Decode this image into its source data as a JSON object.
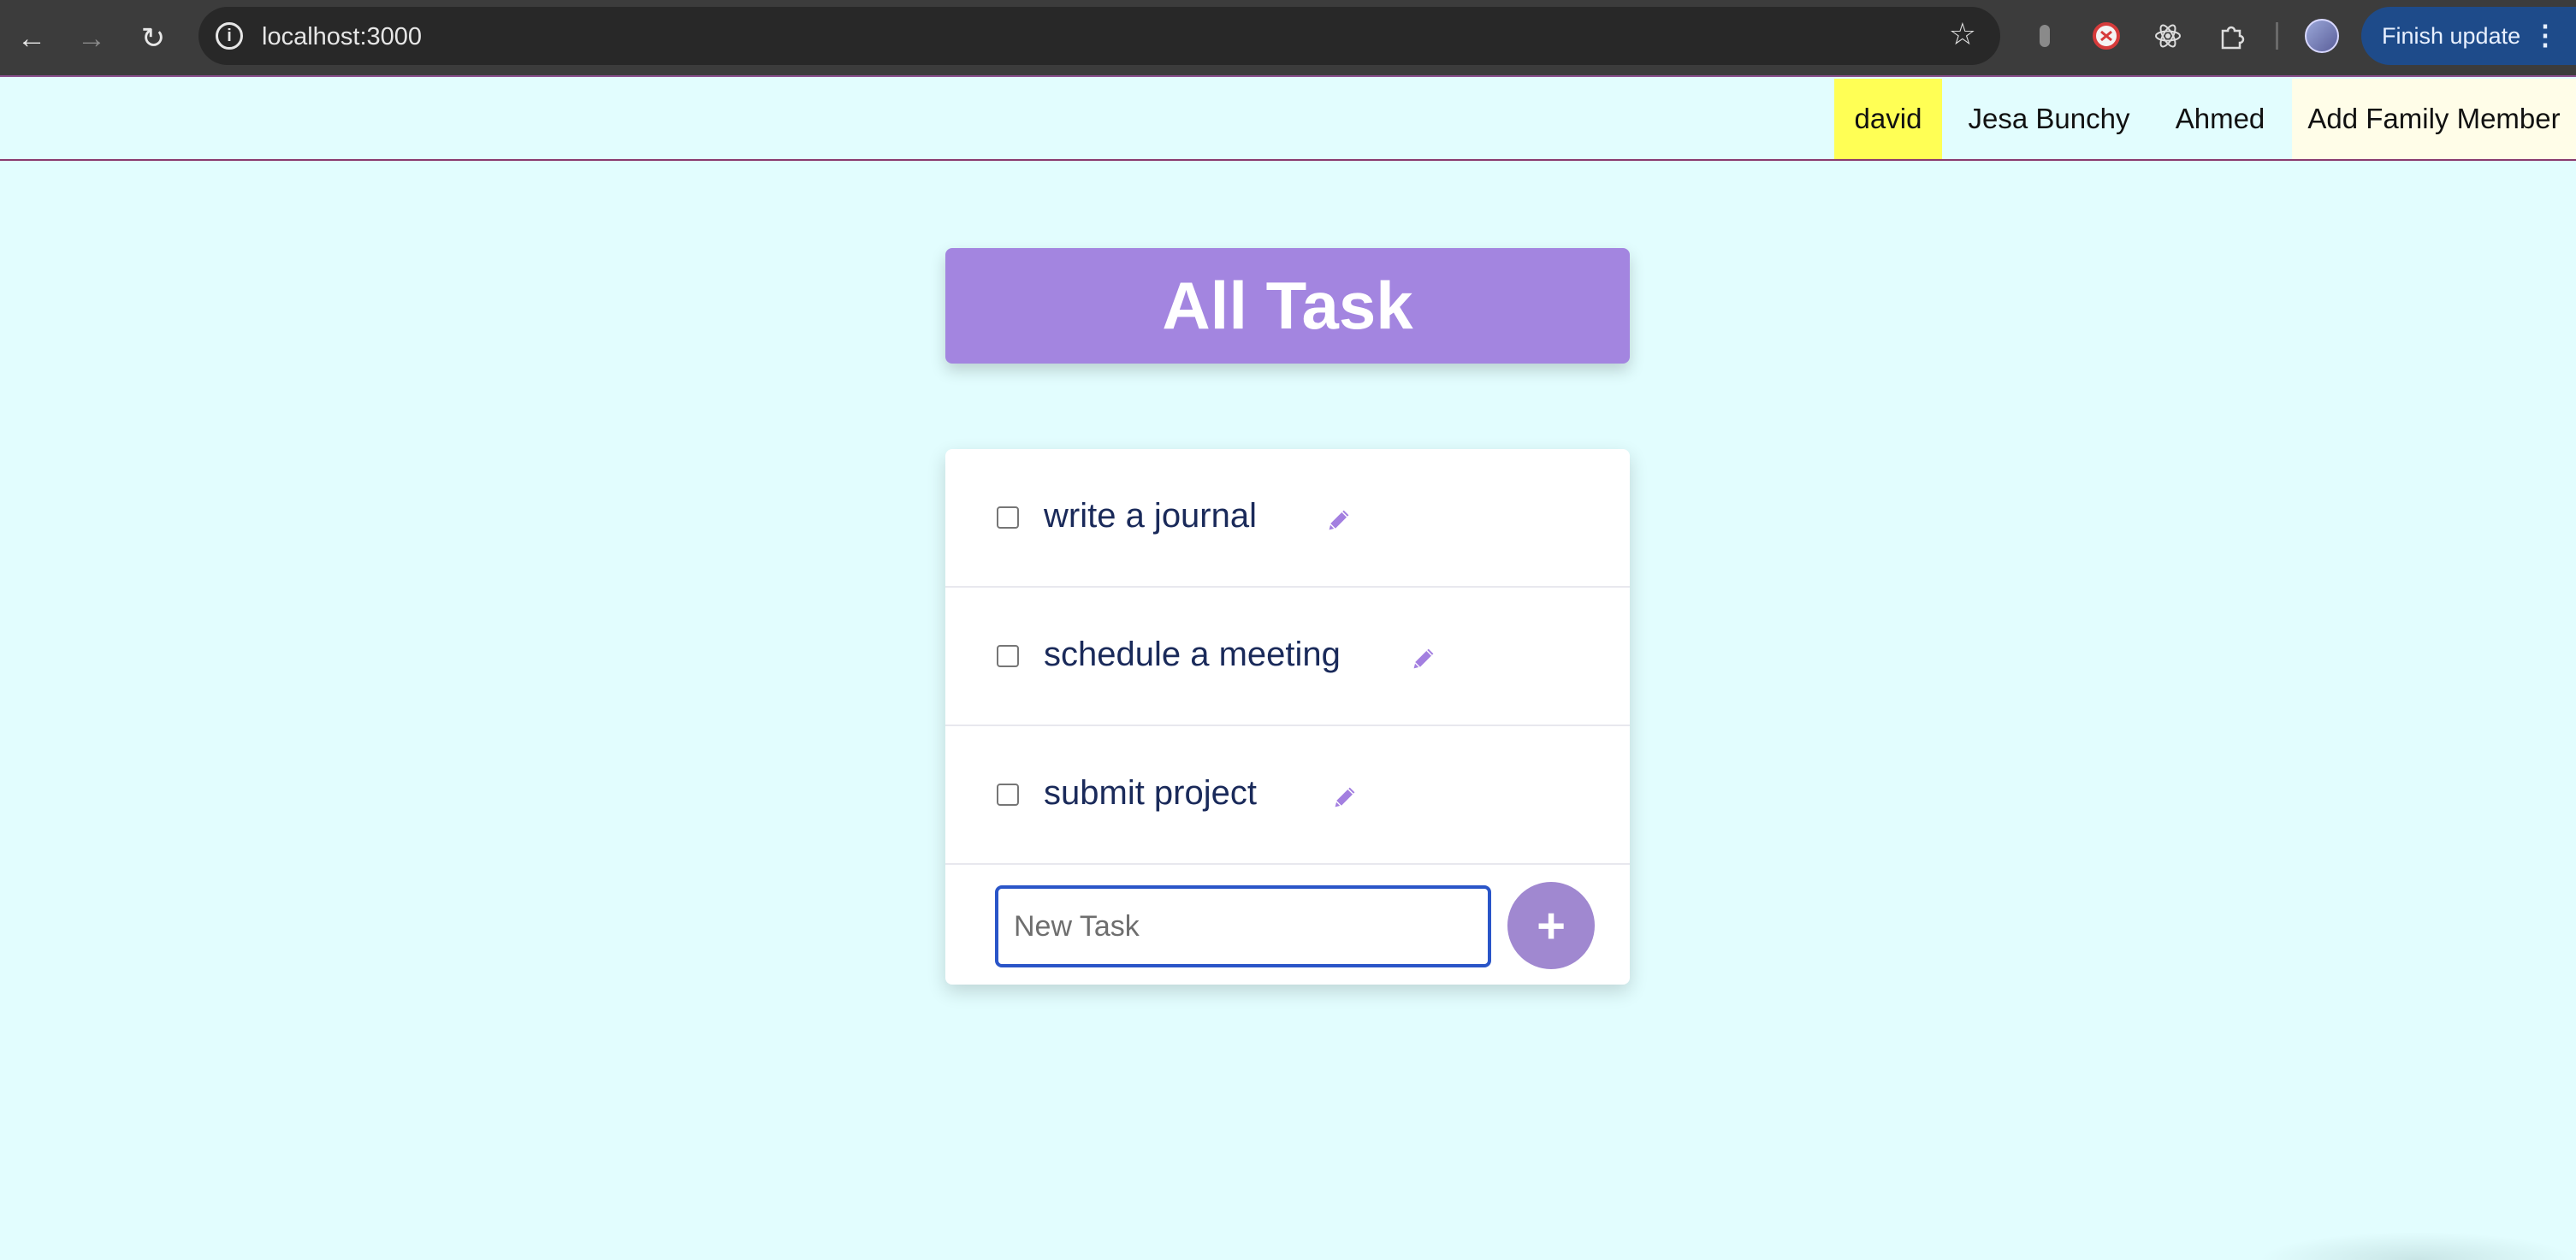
{
  "browser": {
    "url": "localhost:3000",
    "back_icon": "arrow-left-icon",
    "forward_icon": "arrow-right-icon",
    "reload_icon": "reload-icon",
    "info_icon": "info-icon",
    "bookmark_icon": "star-icon",
    "extensions": [
      "extension-icon-1",
      "extension-icon-2",
      "react-icon",
      "puzzle-icon"
    ],
    "profile_icon": "avatar-icon",
    "update_button_label": "Finish update"
  },
  "nav": {
    "items": [
      {
        "label": "david",
        "active": true,
        "color": "#ffff55"
      },
      {
        "label": "Jesa Bunchy",
        "active": false
      },
      {
        "label": "Ahmed",
        "active": false
      },
      {
        "label": "Add Family Member",
        "active": false,
        "color": "#fffde8"
      }
    ]
  },
  "main": {
    "title": "All Task",
    "title_color": "#a385e0",
    "tasks": [
      {
        "label": "write a journal",
        "checked": false
      },
      {
        "label": "schedule a meeting",
        "checked": false
      },
      {
        "label": "submit project",
        "checked": false
      }
    ],
    "new_task": {
      "placeholder": "New Task",
      "value": ""
    },
    "add_button_label": "+",
    "edit_icon": "pencil-icon"
  }
}
